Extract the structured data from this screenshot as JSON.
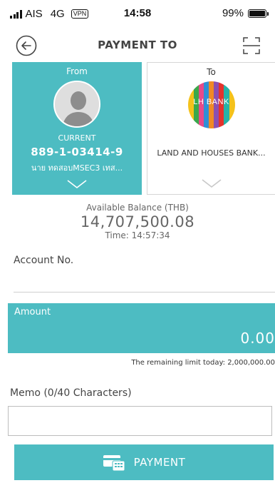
{
  "status_bar": {
    "carrier": "AIS",
    "network": "4G",
    "vpn": "VPN",
    "time": "14:58",
    "battery": "99%"
  },
  "header": {
    "title": "PAYMENT TO"
  },
  "from_card": {
    "label": "From",
    "account_type": "CURRENT",
    "account_number": "889-1-03414-9",
    "account_name": "นาย ทดสอบMSEC3 เทส..."
  },
  "to_card": {
    "label": "To",
    "bank_logo_text": "LH BANK",
    "bank_name": "LAND AND HOUSES BANK..."
  },
  "balance": {
    "label": "Available Balance (THB)",
    "amount": "14,707,500.08",
    "time": "Time: 14:57:34"
  },
  "account_no": {
    "label": "Account No.",
    "value": ""
  },
  "amount": {
    "label": "Amount",
    "value": "0.00"
  },
  "limit_text": "The remaining limit today: 2,000,000.00",
  "memo": {
    "label": "Memo (0/40 Characters)",
    "value": ""
  },
  "payment_button": {
    "label": "PAYMENT"
  },
  "colors": {
    "accent": "#4dbcc2"
  }
}
